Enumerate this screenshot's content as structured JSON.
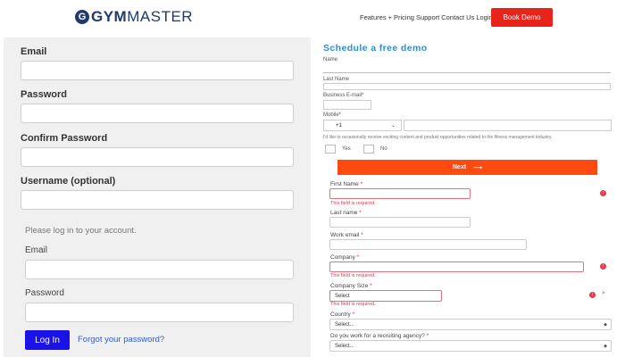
{
  "header": {
    "logo_mark": "G",
    "logo_bold": "GYM",
    "logo_rest": "MASTER",
    "nav": [
      "Features",
      "Pricing",
      "Support",
      "Contact Us",
      "Login"
    ],
    "book_demo": "Book Demo"
  },
  "signup": {
    "email_label": "Email",
    "password_label": "Password",
    "confirm_label": "Confirm Password",
    "username_label": "Username (optional)"
  },
  "login": {
    "intro": "Please log in to your account.",
    "email_label": "Email",
    "password_label": "Password",
    "button": "Log In",
    "forgot": "Forgot your password?"
  },
  "demo": {
    "title": "Schedule a free demo",
    "name_label": "Name",
    "last_name_label": "Last Name",
    "business_email_label": "Business E-mail*",
    "mobile_label": "Mobile*",
    "mobile_code": "+1",
    "consent_text": "I'd like to occasionally receive exciting content and product opportunities related to the fitness management industry.",
    "yes_label": "Yes",
    "no_label": "No",
    "next_button": "Next",
    "next_arrow": "⟶",
    "first_name_label": "First Name",
    "last_name2_label": "Last name",
    "work_email_label": "Work email",
    "company_label": "Company",
    "company_size_label": "Company Size",
    "country_label": "Country",
    "recruiting_label": "Do you work for a recruiting agency?",
    "required_star": "*",
    "required_error": "This field is required.",
    "select_placeholder": "Select...",
    "size_select_value": "Select",
    "colors": {
      "error": "#e23a4a",
      "next_button": "#ff4a12",
      "login_button": "#1b12e8",
      "book_demo": "#e8231a",
      "title": "#2e8fd0"
    }
  }
}
